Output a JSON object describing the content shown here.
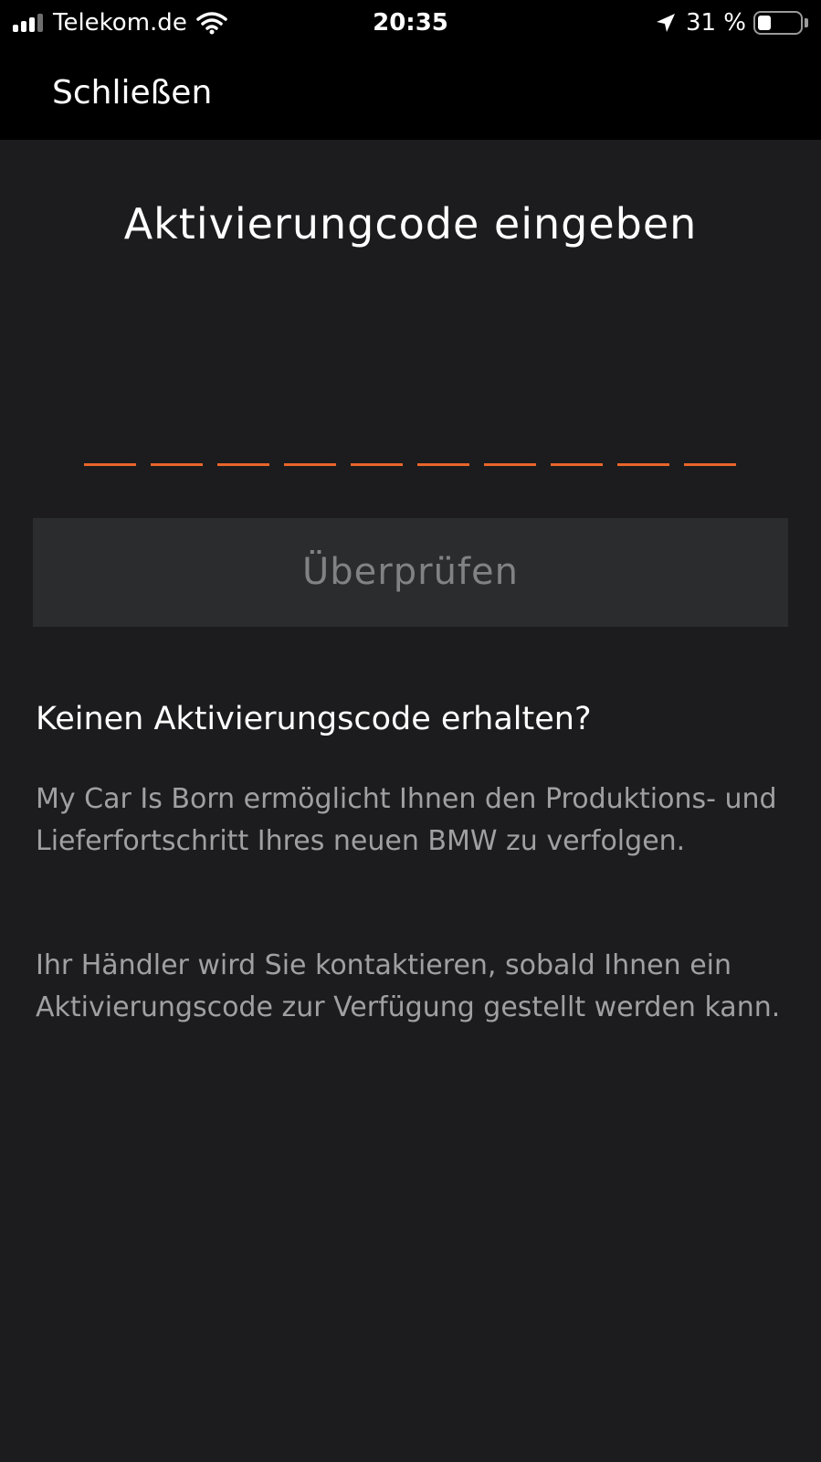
{
  "status_bar": {
    "carrier": "Telekom.de",
    "time": "20:35",
    "battery_percent_label": "31 %",
    "battery_level": 0.31,
    "icons": [
      "cellular-signal-icon",
      "wifi-icon",
      "location-arrow-icon",
      "battery-icon"
    ]
  },
  "nav": {
    "close_label": "Schließen"
  },
  "activation": {
    "title": "Aktivierungcode eingeben",
    "code_length": 10,
    "accent_color": "#e8662a",
    "verify_label": "Überprüfen"
  },
  "help": {
    "heading": "Keinen Aktivierungscode erhalten?",
    "paragraph_1": "My Car Is Born ermöglicht Ihnen den Produktions- und Lieferfortschritt Ihres neuen BMW zu verfolgen.",
    "paragraph_2": "Ihr Händler wird Sie kontaktieren, sobald Ihnen ein Aktivierungscode zur Verfügung gestellt werden kann."
  }
}
